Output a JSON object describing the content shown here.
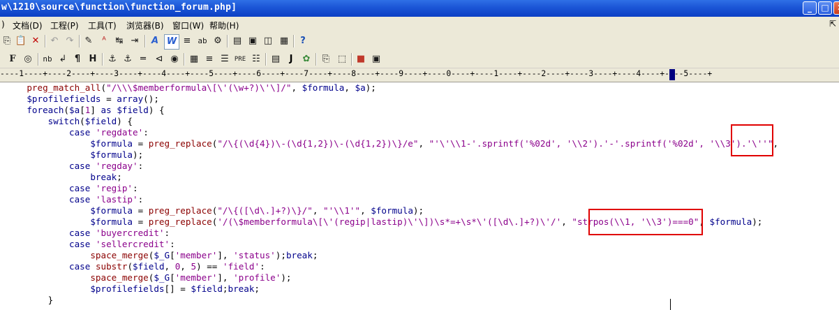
{
  "window": {
    "title": "w\\1210\\source\\function\\function_forum.php]",
    "minimize": "_",
    "maximize": "□",
    "close": "✕"
  },
  "menu": {
    "items": [
      "文档(D)",
      "工程(P)",
      "工具(T)",
      "浏览器(B)",
      "窗口(W)",
      "帮助(H)"
    ],
    "leading": ")",
    "overflow": "⇱"
  },
  "toolbar2": {
    "f_label": "F",
    "nb_label": "nb",
    "para_label": "¶",
    "h_label": "H",
    "pre_label": "PRE",
    "j_label": "J"
  },
  "ruler": {
    "text": "----1----+----2----+----3----+----4----+----5----+----6----+----7----+----8----+----9----+----0----+----1----+----2----+----3----+----4----+----5----+"
  },
  "code_lines": [
    [
      [
        "    ",
        "p"
      ],
      [
        "preg_match_all",
        "f"
      ],
      [
        "(",
        "p"
      ],
      [
        "\"/\\\\\\$memberformula\\[\\'(\\w+?)\\'\\]/\"",
        "s"
      ],
      [
        ", ",
        "p"
      ],
      [
        "$formula",
        "v"
      ],
      [
        ", ",
        "p"
      ],
      [
        "$a",
        "v"
      ],
      [
        ");",
        "p"
      ]
    ],
    [
      [
        "    ",
        "p"
      ],
      [
        "$profilefields",
        "v"
      ],
      [
        " = ",
        "p"
      ],
      [
        "array",
        "k"
      ],
      [
        "();",
        "p"
      ]
    ],
    [
      [
        "    ",
        "p"
      ],
      [
        "foreach",
        "k"
      ],
      [
        "(",
        "p"
      ],
      [
        "$a",
        "v"
      ],
      [
        "[",
        "p"
      ],
      [
        "1",
        "s"
      ],
      [
        "] ",
        "p"
      ],
      [
        "as",
        "k"
      ],
      [
        " ",
        "p"
      ],
      [
        "$field",
        "v"
      ],
      [
        ") {",
        "p"
      ]
    ],
    [
      [
        "        ",
        "p"
      ],
      [
        "switch",
        "k"
      ],
      [
        "(",
        "p"
      ],
      [
        "$field",
        "v"
      ],
      [
        ") {",
        "p"
      ]
    ],
    [
      [
        "            ",
        "p"
      ],
      [
        "case",
        "k"
      ],
      [
        " ",
        "p"
      ],
      [
        "'regdate'",
        "s"
      ],
      [
        ":",
        "p"
      ]
    ],
    [
      [
        "                ",
        "p"
      ],
      [
        "$formula",
        "v"
      ],
      [
        " = ",
        "p"
      ],
      [
        "preg_replace",
        "f"
      ],
      [
        "(",
        "p"
      ],
      [
        "\"/\\{(\\d{4})\\-(\\d{1,2})\\-(\\d{1,2})\\}/e\"",
        "s"
      ],
      [
        ", ",
        "p"
      ],
      [
        "\"'\\'\\\\1-'.sprintf('%02d', '\\\\2').'-'.sprintf('%02d', '\\\\3').'\\''\"",
        "s"
      ],
      [
        ",",
        "p"
      ]
    ],
    [
      [
        "                ",
        "p"
      ],
      [
        "$formula",
        "v"
      ],
      [
        ");",
        "p"
      ]
    ],
    [
      [
        "            ",
        "p"
      ],
      [
        "case",
        "k"
      ],
      [
        " ",
        "p"
      ],
      [
        "'regday'",
        "s"
      ],
      [
        ":",
        "p"
      ]
    ],
    [
      [
        "                ",
        "p"
      ],
      [
        "break",
        "k"
      ],
      [
        ";",
        "p"
      ]
    ],
    [
      [
        "            ",
        "p"
      ],
      [
        "case",
        "k"
      ],
      [
        " ",
        "p"
      ],
      [
        "'regip'",
        "s"
      ],
      [
        ":",
        "p"
      ]
    ],
    [
      [
        "            ",
        "p"
      ],
      [
        "case",
        "k"
      ],
      [
        " ",
        "p"
      ],
      [
        "'lastip'",
        "s"
      ],
      [
        ":",
        "p"
      ]
    ],
    [
      [
        "                ",
        "p"
      ],
      [
        "$formula",
        "v"
      ],
      [
        " = ",
        "p"
      ],
      [
        "preg_replace",
        "f"
      ],
      [
        "(",
        "p"
      ],
      [
        "\"/\\{([\\d\\.]+?)\\}/\"",
        "s"
      ],
      [
        ", ",
        "p"
      ],
      [
        "\"'\\\\1'\"",
        "s"
      ],
      [
        ", ",
        "p"
      ],
      [
        "$formula",
        "v"
      ],
      [
        ");",
        "p"
      ]
    ],
    [
      [
        "                ",
        "p"
      ],
      [
        "$formula",
        "v"
      ],
      [
        " = ",
        "p"
      ],
      [
        "preg_replace",
        "f"
      ],
      [
        "(",
        "p"
      ],
      [
        "'/(\\$memberformula\\[\\'(regip|lastip)\\'\\])\\s*=+\\s*\\'([\\d\\.]+?)\\'/'",
        "s"
      ],
      [
        ", ",
        "p"
      ],
      [
        "\"strpos(\\\\1, '\\\\3')===0\"",
        "s"
      ],
      [
        ", ",
        "p"
      ],
      [
        "$formula",
        "v"
      ],
      [
        ");",
        "p"
      ]
    ],
    [
      [
        "            ",
        "p"
      ],
      [
        "case",
        "k"
      ],
      [
        " ",
        "p"
      ],
      [
        "'buyercredit'",
        "s"
      ],
      [
        ":",
        "p"
      ]
    ],
    [
      [
        "            ",
        "p"
      ],
      [
        "case",
        "k"
      ],
      [
        " ",
        "p"
      ],
      [
        "'sellercredit'",
        "s"
      ],
      [
        ":",
        "p"
      ]
    ],
    [
      [
        "                ",
        "p"
      ],
      [
        "space_merge",
        "f"
      ],
      [
        "(",
        "p"
      ],
      [
        "$_G",
        "v"
      ],
      [
        "[",
        "p"
      ],
      [
        "'member'",
        "s"
      ],
      [
        "], ",
        "p"
      ],
      [
        "'status'",
        "s"
      ],
      [
        ");",
        "p"
      ],
      [
        "break",
        "k"
      ],
      [
        ";",
        "p"
      ]
    ],
    [
      [
        "            ",
        "p"
      ],
      [
        "case",
        "k"
      ],
      [
        " ",
        "p"
      ],
      [
        "substr",
        "f"
      ],
      [
        "(",
        "p"
      ],
      [
        "$field",
        "v"
      ],
      [
        ", ",
        "p"
      ],
      [
        "0",
        "s"
      ],
      [
        ", ",
        "p"
      ],
      [
        "5",
        "s"
      ],
      [
        ") == ",
        "p"
      ],
      [
        "'field'",
        "s"
      ],
      [
        ":",
        "p"
      ]
    ],
    [
      [
        "                ",
        "p"
      ],
      [
        "space_merge",
        "f"
      ],
      [
        "(",
        "p"
      ],
      [
        "$_G",
        "v"
      ],
      [
        "[",
        "p"
      ],
      [
        "'member'",
        "s"
      ],
      [
        "], ",
        "p"
      ],
      [
        "'profile'",
        "s"
      ],
      [
        ");",
        "p"
      ]
    ],
    [
      [
        "                ",
        "p"
      ],
      [
        "$profilefields",
        "v"
      ],
      [
        "[] = ",
        "p"
      ],
      [
        "$field",
        "v"
      ],
      [
        ";",
        "p"
      ],
      [
        "break",
        "k"
      ],
      [
        ";",
        "p"
      ]
    ],
    [
      [
        "        ",
        "p"
      ],
      [
        "}",
        "p"
      ]
    ]
  ]
}
